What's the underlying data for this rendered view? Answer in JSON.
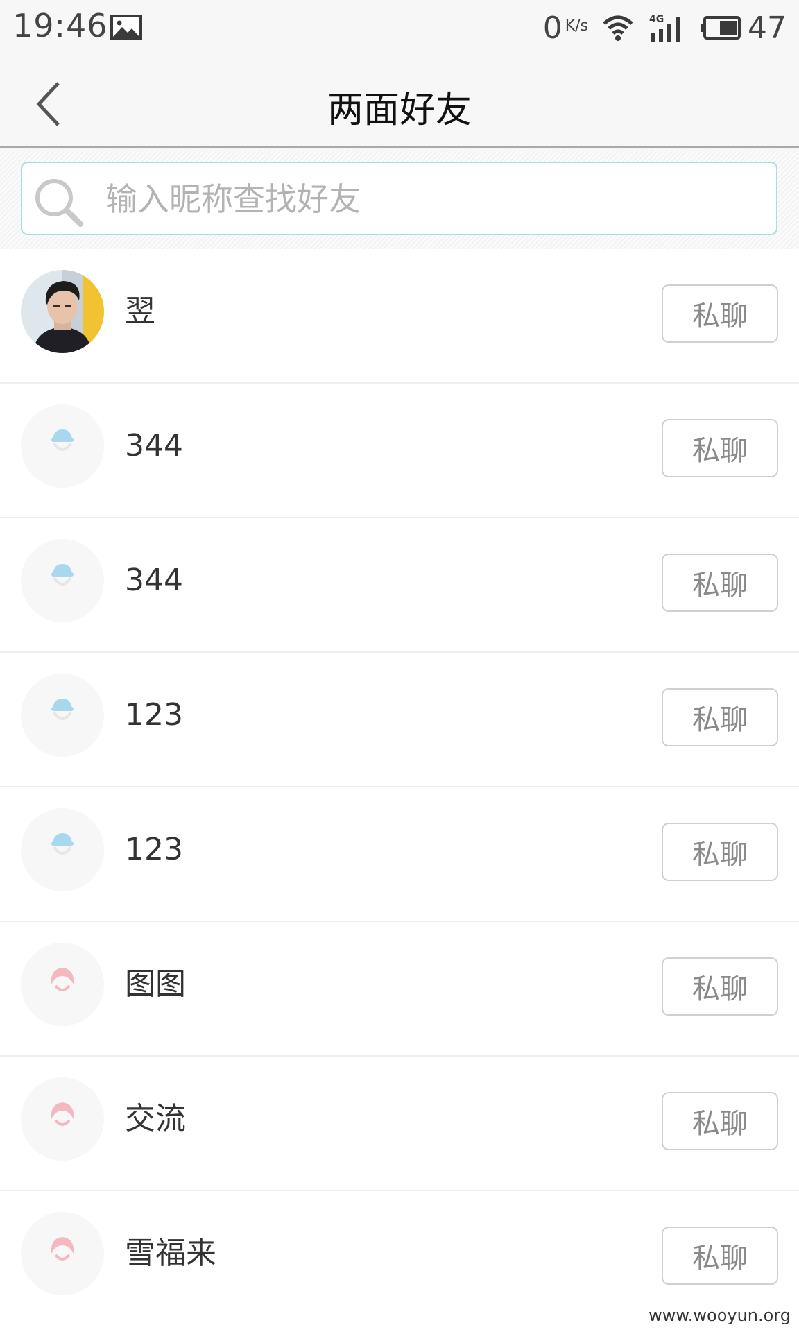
{
  "status_bar": {
    "time": "19:46",
    "net_speed": "0",
    "net_speed_unit": "K/s",
    "network_type": "4G",
    "battery_level": "47"
  },
  "header": {
    "title": "两面好友"
  },
  "search": {
    "placeholder": "输入昵称查找好友"
  },
  "friends": [
    {
      "name": "翌",
      "chat_label": "私聊",
      "avatar": "photo-avatar"
    },
    {
      "name": "344",
      "chat_label": "私聊",
      "avatar": "default-blue-avatar"
    },
    {
      "name": "344",
      "chat_label": "私聊",
      "avatar": "default-blue-avatar"
    },
    {
      "name": "123",
      "chat_label": "私聊",
      "avatar": "default-blue-avatar"
    },
    {
      "name": "123",
      "chat_label": "私聊",
      "avatar": "default-blue-avatar"
    },
    {
      "name": "图图",
      "chat_label": "私聊",
      "avatar": "default-pink-avatar"
    },
    {
      "name": "交流",
      "chat_label": "私聊",
      "avatar": "default-pink-avatar"
    },
    {
      "name": "雪福来",
      "chat_label": "私聊",
      "avatar": "default-pink-avatar"
    }
  ],
  "watermark": "www.wooyun.org",
  "colors": {
    "search_border": "#a8dde6",
    "header_bg": "#f7f7f7",
    "button_text": "#8a8a8a",
    "default_avatar_blue": "#a9d8ee",
    "default_avatar_pink": "#f3b8c0"
  }
}
